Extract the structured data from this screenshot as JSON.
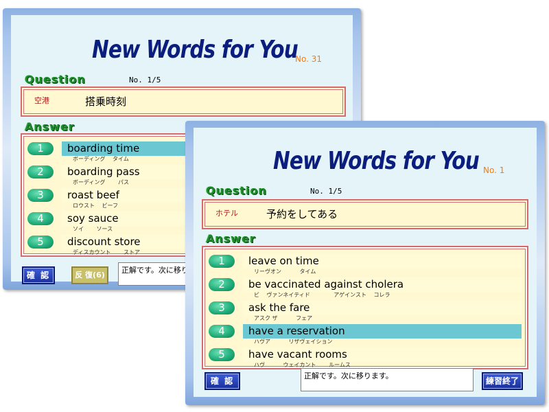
{
  "back_window": {
    "app_title": "New Words for You",
    "number": "No. 31",
    "question_heading": "Question",
    "question_count": "No. 1/5",
    "question_label": "空港",
    "question_text": "搭乗時刻",
    "answer_heading": "Answer",
    "answers": [
      {
        "num": "1",
        "text": "boarding time",
        "kana": "ボーディング　 タイム",
        "selected": true
      },
      {
        "num": "2",
        "text": "boarding pass",
        "kana": "ボーディング　 　パス",
        "selected": false
      },
      {
        "num": "3",
        "text": "roast beef",
        "kana": "ロウスト　 ビーフ",
        "selected": false
      },
      {
        "num": "4",
        "text": "soy sauce",
        "kana": "ソイ　 　ソース",
        "selected": false
      },
      {
        "num": "5",
        "text": "discount store",
        "kana": "ディスカウント　 　ストア",
        "selected": false
      }
    ],
    "confirm_label": "確 認",
    "repeat_label": "反 復(6)",
    "status_text": "正解です。次に移ります。"
  },
  "front_window": {
    "app_title": "New Words for You",
    "number": "No. 1",
    "question_heading": "Question",
    "question_count": "No. 1/5",
    "question_label": "ホテル",
    "question_text": "予約をしてある",
    "answer_heading": "Answer",
    "answers": [
      {
        "num": "1",
        "text": "leave on time",
        "kana": "リーヴオン　 　　タイム",
        "selected": false
      },
      {
        "num": "2",
        "text": "be vaccinated against cholera",
        "kana": "ビ　 ヴァンネイティド　　 　　アゲインスト　 コレラ",
        "selected": false
      },
      {
        "num": "3",
        "text": "ask the fare",
        "kana": "アスク ザ　 　　フェア",
        "selected": false
      },
      {
        "num": "4",
        "text": "have a reservation",
        "kana": "ハヴア　 　　リザヴェイション",
        "selected": true
      },
      {
        "num": "5",
        "text": "have vacant rooms",
        "kana": "ハヴ　 　　ウェイカント　　 ルームス",
        "selected": false
      }
    ],
    "confirm_label": "確 認",
    "finish_label": "練習終了",
    "status_text": "正解です。次に移ります。"
  },
  "colors": {
    "title": "#0c1e7d",
    "number": "#ff7a00",
    "selected_bar": "#6bc7d2",
    "answer_bar": "#fffbd6",
    "pill": "#22b07c",
    "border_red": "#d66a6a"
  }
}
